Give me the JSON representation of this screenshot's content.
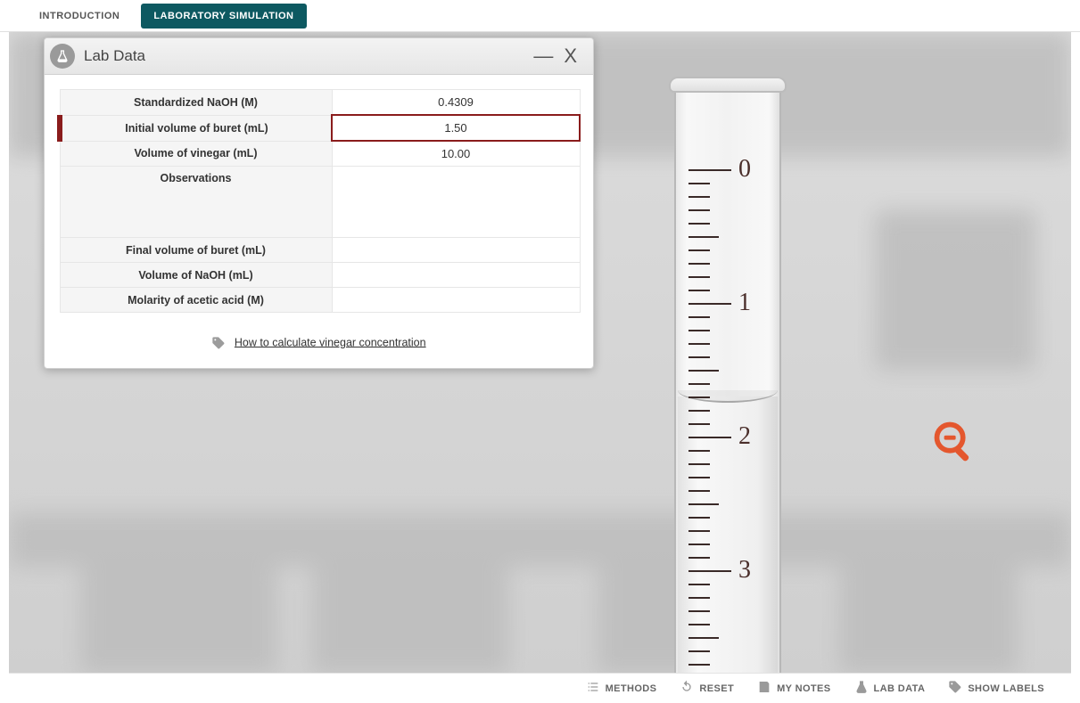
{
  "tabs": {
    "intro": "INTRODUCTION",
    "sim": "LABORATORY SIMULATION"
  },
  "panel": {
    "title": "Lab Data",
    "rows": {
      "naoh_molarity_label": "Standardized NaOH (M)",
      "naoh_molarity_value": "0.4309",
      "init_vol_label": "Initial volume of buret (mL)",
      "init_vol_value": "1.50",
      "vinegar_vol_label": "Volume of vinegar (mL)",
      "vinegar_vol_value": "10.00",
      "observations_label": "Observations",
      "observations_value": "",
      "final_vol_label": "Final volume of buret (mL)",
      "final_vol_value": "",
      "naoh_vol_label": "Volume of NaOH (mL)",
      "naoh_vol_value": "",
      "acetic_molarity_label": "Molarity of acetic acid (M)",
      "acetic_molarity_value": ""
    },
    "hint": "How to calculate vinegar concentration"
  },
  "buret": {
    "labels": [
      "0",
      "1",
      "2",
      "3"
    ]
  },
  "toolbar": {
    "methods": "METHODS",
    "reset": "RESET",
    "mynotes": "MY NOTES",
    "labdata": "LAB DATA",
    "showlabels": "SHOW LABELS"
  }
}
